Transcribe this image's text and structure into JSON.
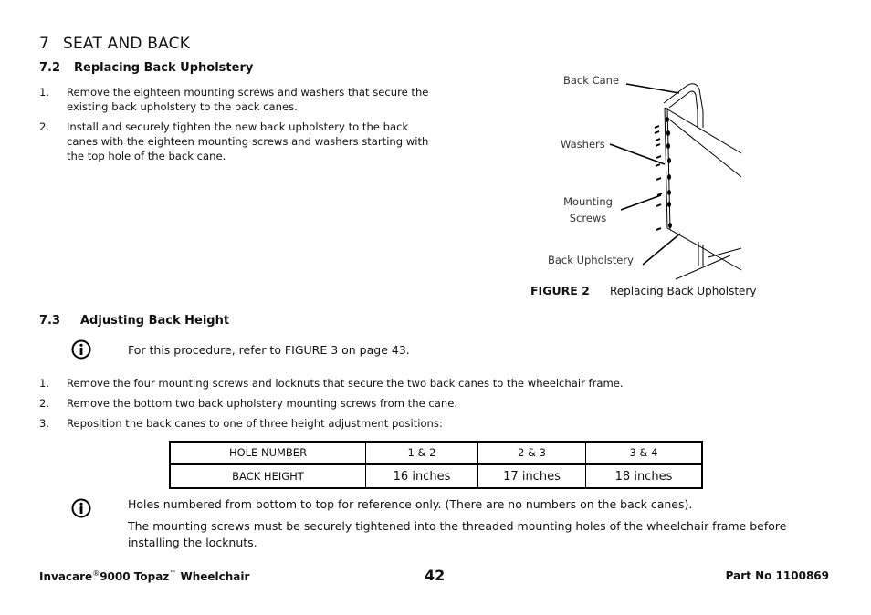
{
  "chapter": {
    "number": "7",
    "title": "SEAT AND BACK"
  },
  "section_72": {
    "number": "7.2",
    "title": "Replacing Back Upholstery",
    "steps": [
      {
        "n": "1.",
        "text": "Remove the eighteen mounting screws and washers that secure the existing back upholstery to the back canes."
      },
      {
        "n": "2.",
        "text": "Install and securely tighten the new back upholstery to the back canes with the eighteen mounting screws and washers starting with the top hole of the back cane."
      }
    ]
  },
  "figure": {
    "labels": {
      "back_cane": "Back Cane",
      "washers": "Washers",
      "mounting_screws_1": "Mounting",
      "mounting_screws_2": "Screws",
      "back_upholstery": "Back Upholstery"
    },
    "caption_number": "FIGURE 2",
    "caption_text": "Replacing Back Upholstery"
  },
  "section_73": {
    "number": "7.3",
    "title": "Adjusting Back Height",
    "note": "For this procedure, refer to FIGURE 3 on page 43.",
    "steps": [
      {
        "n": "1.",
        "text": "Remove the four mounting screws and locknuts that secure the two back canes to the wheelchair frame."
      },
      {
        "n": "2.",
        "text": "Remove the bottom two back upholstery mounting screws from the cane."
      },
      {
        "n": "3.",
        "text": "Reposition the back canes to one of three height adjustment positions:"
      }
    ]
  },
  "height_table": {
    "rows": [
      [
        "HOLE NUMBER",
        "1 & 2",
        "2 & 3",
        "3 & 4"
      ],
      [
        "BACK HEIGHT",
        "16 inches",
        "17 inches",
        "18 inches"
      ]
    ]
  },
  "notes": {
    "note_icon": "info-icon",
    "line1": "Holes numbered from bottom to top for reference only. (There are no numbers on the back canes).",
    "line2": "The mounting screws must be securely tightened into the threaded mounting holes of the wheelchair frame before installing the locknuts."
  },
  "footer": {
    "brand": "Invacare",
    "reg": "®",
    "model": "9000 Topaz",
    "tm": "™",
    "product": "Wheelchair",
    "page": "42",
    "part": "Part No 1100869"
  }
}
